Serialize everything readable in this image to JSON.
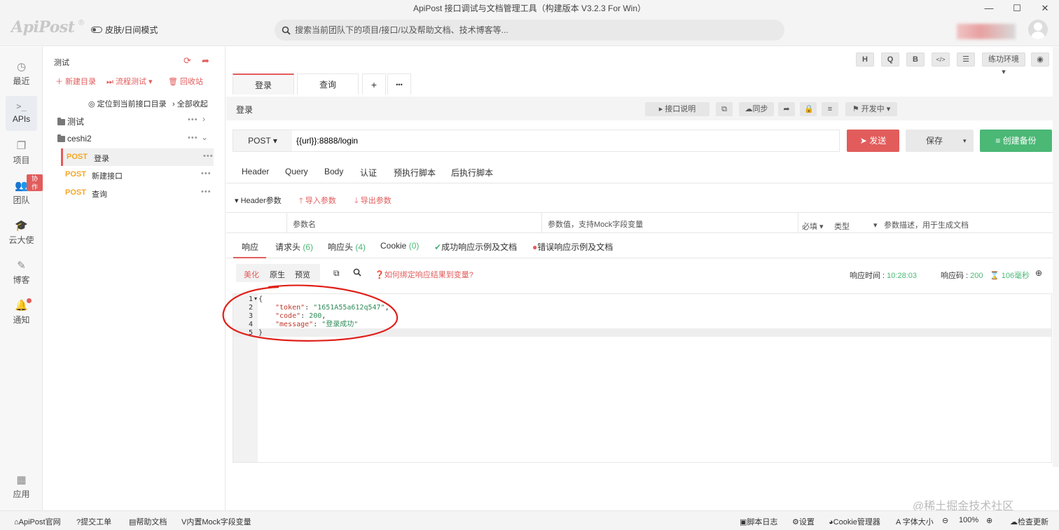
{
  "window": {
    "title": "ApiPost 接口调试与文档管理工具（构建版本 V3.2.3 For Win）"
  },
  "header": {
    "logo": "ApiPost",
    "logo_mark": "®",
    "skin_mode": "皮肤/日间模式",
    "search_placeholder": "搜索当前团队下的项目/接口/以及帮助文档、技术博客等..."
  },
  "leftnav": {
    "items": [
      {
        "label": "最近"
      },
      {
        "label": "APIs"
      },
      {
        "label": "项目"
      },
      {
        "label": "团队",
        "badge": "协作"
      },
      {
        "label": "云大使"
      },
      {
        "label": "博客"
      },
      {
        "label": "通知"
      },
      {
        "label": "应用"
      }
    ]
  },
  "tree": {
    "project": "测试",
    "new_dir": "新建目录",
    "flow_test": "流程测试",
    "recycle": "回收站",
    "locate": "定位到当前接口目录",
    "collapse_all": "全部收起",
    "folders": [
      {
        "name": "测试"
      },
      {
        "name": "ceshi2"
      }
    ],
    "apis": [
      {
        "method": "POST",
        "name": "登录"
      },
      {
        "method": "POST",
        "name": "新建接口"
      },
      {
        "method": "POST",
        "name": "查询"
      }
    ]
  },
  "toolbar": {
    "buttons": [
      "H",
      "Q",
      "B",
      "</>",
      "☰"
    ],
    "env": "练功环境"
  },
  "tabs": [
    {
      "label": "登录"
    },
    {
      "label": "查询"
    },
    {
      "label": "+"
    },
    {
      "label": "•••"
    }
  ],
  "api_bar": {
    "name": "登录",
    "doc": "接口说明",
    "sync": "同步",
    "status": "开发中"
  },
  "request": {
    "method": "POST",
    "url": "{{url}}:8888/login",
    "send": "发送",
    "save": "保存",
    "backup": "创建备份"
  },
  "req_tabs": [
    "Header",
    "Query",
    "Body",
    "认证",
    "预执行脚本",
    "后执行脚本"
  ],
  "header_params": {
    "title": "Header参数",
    "import": "导入参数",
    "export": "导出参数",
    "col_name": "参数名",
    "col_value": "参数值，支持Mock字段变量",
    "col_required": "必填",
    "col_type": "类型",
    "col_desc": "参数描述，用于生成文档"
  },
  "resp_tabs": {
    "response": "响应",
    "req_headers": "请求头",
    "req_headers_count": "(6)",
    "resp_headers": "响应头",
    "resp_headers_count": "(4)",
    "cookie": "Cookie",
    "cookie_count": "(0)",
    "success_example": "成功响应示例及文档",
    "error_example": "错误响应示例及文档"
  },
  "resp_view": {
    "pretty": "美化",
    "raw": "原生",
    "preview": "预览",
    "bind_tip": "如何绑定响应结果到变量?",
    "time_label": "响应时间 : ",
    "time_value": "10:28:03",
    "code_label": "响应码 : ",
    "code_value": "200",
    "duration": "106毫秒"
  },
  "code": {
    "lines": [
      "1",
      "2",
      "3",
      "4",
      "5"
    ],
    "open": "{",
    "token_key": "\"token\"",
    "token_val": "\"1651A55a612q547\"",
    "code_key": "\"code\"",
    "code_val": "200",
    "msg_key": "\"message\"",
    "msg_val": "\"登录成功\"",
    "close": "}"
  },
  "statusbar": {
    "site": "ApiPost官网",
    "ticket": "提交工单",
    "help": "帮助文档",
    "mock": "内置Mock字段变量",
    "script_log": "脚本日志",
    "settings": "设置",
    "cookie_mgr": "Cookie管理器",
    "font_size": "字体大小",
    "zoom": "100%",
    "update": "检查更新"
  },
  "watermark": "@稀土掘金技术社区",
  "colors": {
    "accent": "#e25c5c",
    "post": "#f5a623",
    "backup": "#4bb876",
    "annotation": "#e0201a"
  }
}
